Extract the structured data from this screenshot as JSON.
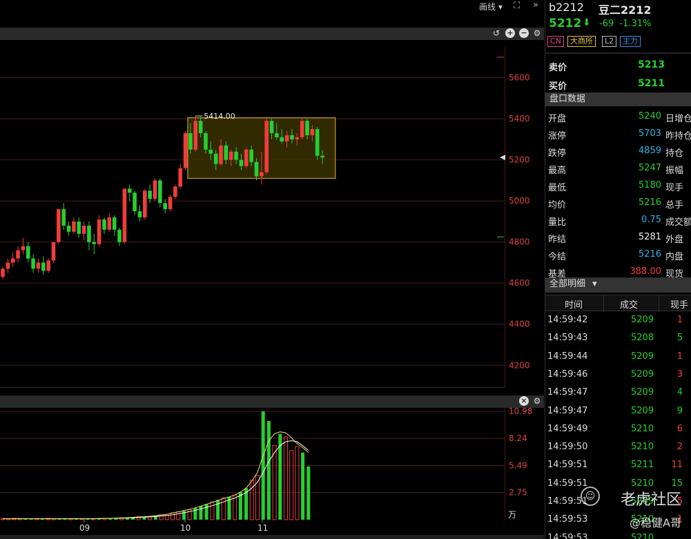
{
  "toolbar": {
    "draw_menu_label": "画线 ▾",
    "fullscreen_icon": "fullscreen-icon",
    "expand_icon": "expand-icon",
    "expand_glyph": "»",
    "fullscreen_glyph": "⛶"
  },
  "price_pane": {
    "icons": [
      "undo-icon",
      "zoom-in-icon",
      "zoom-out-icon",
      "gear-icon"
    ]
  },
  "vol_pane": {
    "icons": [
      "close-icon",
      "gear-icon"
    ]
  },
  "header": {
    "symbol_code": "b2212",
    "symbol_name": "豆二2212",
    "last_price": "5212",
    "arrow": "🡇",
    "change": "-69",
    "change_pct": "-1.31%",
    "tags": [
      {
        "label": "CN",
        "color": "#e2438a"
      },
      {
        "label": "大商所",
        "color": "#e2c23a"
      },
      {
        "label": "L2",
        "color": "#bbbbbb"
      },
      {
        "label": "主力",
        "color": "#3a8ee2"
      }
    ]
  },
  "quotes": [
    {
      "label": "卖价",
      "value": "5213"
    },
    {
      "label": "买价",
      "value": "5211"
    }
  ],
  "market_data": {
    "title": "盘口数据",
    "rows": [
      {
        "label": "开盘",
        "value": "5240",
        "color": "#25d02f",
        "label2": "日增仓"
      },
      {
        "label": "涨停",
        "value": "5703",
        "color": "#2eb8e8",
        "label2": "昨持仓"
      },
      {
        "label": "跌停",
        "value": "4859",
        "color": "#2eb8e8",
        "label2": "持仓"
      },
      {
        "label": "最高",
        "value": "5247",
        "color": "#25d02f",
        "label2": "振幅"
      },
      {
        "label": "最低",
        "value": "5180",
        "color": "#25d02f",
        "label2": "现手"
      },
      {
        "label": "均价",
        "value": "5216",
        "color": "#25d02f",
        "label2": "总手"
      },
      {
        "label": "量比",
        "value": "0.75",
        "color": "#2eb8e8",
        "label2": "成交额"
      },
      {
        "label": "昨结",
        "value": "5281",
        "color": "#eeeeee",
        "label2": "外盘"
      },
      {
        "label": "今结",
        "value": "5216",
        "color": "#2eb8e8",
        "label2": "内盘"
      },
      {
        "label": "基差",
        "value": "388.00",
        "color": "#f03c3c",
        "label2": "现货"
      }
    ]
  },
  "ticks": {
    "title": "全部明细",
    "dropdown_icon": "▾",
    "headers": [
      "时间",
      "成交",
      "现手"
    ],
    "rows": [
      {
        "time": "14:59:42",
        "price": "5209",
        "vol": "1",
        "color": "#f03c3c"
      },
      {
        "time": "14:59:43",
        "price": "5208",
        "vol": "5",
        "color": "#25d02f"
      },
      {
        "time": "14:59:44",
        "price": "5209",
        "vol": "1",
        "color": "#f03c3c"
      },
      {
        "time": "14:59:46",
        "price": "5209",
        "vol": "3",
        "color": "#f03c3c"
      },
      {
        "time": "14:59:47",
        "price": "5209",
        "vol": "4",
        "color": "#25d02f"
      },
      {
        "time": "14:59:47",
        "price": "5209",
        "vol": "9",
        "color": "#25d02f"
      },
      {
        "time": "14:59:49",
        "price": "5210",
        "vol": "6",
        "color": "#f03c3c"
      },
      {
        "time": "14:59:50",
        "price": "5210",
        "vol": "2",
        "color": "#f03c3c"
      },
      {
        "time": "14:59:51",
        "price": "5211",
        "vol": "11",
        "color": "#f03c3c"
      },
      {
        "time": "14:59:51",
        "price": "5210",
        "vol": "15",
        "color": "#25d02f"
      },
      {
        "time": "14:59:51",
        "price": "5209",
        "vol": "5",
        "color": "#f03c3c"
      },
      {
        "time": "14:59:53",
        "price": "5210",
        "vol": "1",
        "color": "#f03c3c"
      },
      {
        "time": "14:59:53",
        "price": "5210",
        "vol": "",
        "color": "#f03c3c"
      }
    ]
  },
  "watermark": {
    "site": "老虎社区",
    "author": "@稳健A哥",
    "icon": "tiger-logo-icon"
  },
  "colors": {
    "up": "#f03c3c",
    "down": "#25d02f",
    "box_border": "#c8a020",
    "box_fill": "#3a3000",
    "ma_yellow": "#f0e060",
    "ma_white": "#ffffff"
  },
  "chart_data": [
    {
      "type": "candlestick",
      "y_ticks": [
        4200,
        4400,
        4600,
        4800,
        5000,
        5200,
        5400,
        5600
      ],
      "y_tick_labels": [
        "4200",
        "4400",
        "4600",
        "4800",
        "5000",
        "5200",
        "5400",
        "5600"
      ],
      "ylim": [
        4090,
        5750
      ],
      "x_labels": [
        "09",
        "10",
        "11"
      ],
      "grid": true,
      "annotation": {
        "label": "5414.00",
        "value": 5414
      },
      "consolidation_box": {
        "start_index": 37,
        "end_index": 65,
        "high": 5405,
        "low": 5110
      },
      "candles": [
        [
          4630,
          4680,
          4620,
          4670
        ],
        [
          4670,
          4720,
          4650,
          4700
        ],
        [
          4700,
          4750,
          4680,
          4720
        ],
        [
          4720,
          4780,
          4700,
          4760
        ],
        [
          4760,
          4820,
          4740,
          4780
        ],
        [
          4780,
          4800,
          4700,
          4720
        ],
        [
          4720,
          4740,
          4650,
          4670
        ],
        [
          4670,
          4720,
          4650,
          4700
        ],
        [
          4700,
          4730,
          4640,
          4660
        ],
        [
          4660,
          4720,
          4650,
          4710
        ],
        [
          4710,
          4800,
          4700,
          4800
        ],
        [
          4800,
          4960,
          4790,
          4960
        ],
        [
          4960,
          4990,
          4860,
          4880
        ],
        [
          4880,
          4900,
          4830,
          4850
        ],
        [
          4850,
          4920,
          4840,
          4900
        ],
        [
          4900,
          4920,
          4820,
          4840
        ],
        [
          4840,
          4900,
          4810,
          4880
        ],
        [
          4880,
          4900,
          4760,
          4800
        ],
        [
          4800,
          4840,
          4740,
          4790
        ],
        [
          4790,
          4930,
          4780,
          4910
        ],
        [
          4910,
          4920,
          4840,
          4860
        ],
        [
          4860,
          4940,
          4850,
          4920
        ],
        [
          4920,
          4930,
          4830,
          4860
        ],
        [
          4860,
          4870,
          4780,
          4800
        ],
        [
          4800,
          5060,
          4790,
          5060
        ],
        [
          5060,
          5080,
          5000,
          5040
        ],
        [
          5040,
          5050,
          4930,
          4950
        ],
        [
          4950,
          4980,
          4900,
          4920
        ],
        [
          4920,
          5060,
          4910,
          5050
        ],
        [
          5050,
          5080,
          4990,
          5010
        ],
        [
          5010,
          5110,
          5000,
          5100
        ],
        [
          5100,
          5110,
          4970,
          4990
        ],
        [
          4990,
          5010,
          4940,
          4960
        ],
        [
          4960,
          5030,
          4950,
          5020
        ],
        [
          5020,
          5080,
          5010,
          5070
        ],
        [
          5070,
          5180,
          5060,
          5160
        ],
        [
          5160,
          5340,
          5150,
          5330
        ],
        [
          5330,
          5380,
          5230,
          5250
        ],
        [
          5250,
          5414,
          5240,
          5390
        ],
        [
          5390,
          5410,
          5310,
          5330
        ],
        [
          5330,
          5340,
          5230,
          5250
        ],
        [
          5250,
          5290,
          5200,
          5230
        ],
        [
          5230,
          5250,
          5150,
          5180
        ],
        [
          5180,
          5300,
          5170,
          5270
        ],
        [
          5270,
          5290,
          5180,
          5200
        ],
        [
          5200,
          5250,
          5170,
          5240
        ],
        [
          5240,
          5260,
          5180,
          5200
        ],
        [
          5200,
          5230,
          5150,
          5170
        ],
        [
          5170,
          5260,
          5160,
          5250
        ],
        [
          5250,
          5270,
          5170,
          5190
        ],
        [
          5190,
          5210,
          5100,
          5120
        ],
        [
          5120,
          5240,
          5080,
          5140
        ],
        [
          5140,
          5410,
          5130,
          5390
        ],
        [
          5390,
          5400,
          5300,
          5330
        ],
        [
          5330,
          5380,
          5300,
          5310
        ],
        [
          5310,
          5350,
          5280,
          5290
        ],
        [
          5290,
          5340,
          5260,
          5320
        ],
        [
          5320,
          5350,
          5280,
          5300
        ],
        [
          5300,
          5330,
          5270,
          5310
        ],
        [
          5310,
          5400,
          5300,
          5390
        ],
        [
          5390,
          5400,
          5300,
          5320
        ],
        [
          5320,
          5370,
          5290,
          5350
        ],
        [
          5350,
          5360,
          5200,
          5220
        ],
        [
          5220,
          5247,
          5180,
          5212
        ]
      ]
    },
    {
      "type": "bar",
      "y_ticks": [
        2.75,
        5.49,
        8.24,
        10.98
      ],
      "y_tick_labels": [
        "2.75",
        "5.49",
        "8.24",
        "10.98"
      ],
      "unit": "万",
      "ylim": [
        0,
        10.98
      ],
      "values": [
        0.1,
        0.1,
        0.15,
        0.12,
        0.1,
        0.1,
        0.12,
        0.1,
        0.15,
        0.1,
        0.12,
        0.1,
        0.12,
        0.15,
        0.1,
        0.12,
        0.1,
        0.15,
        0.12,
        0.1,
        0.18,
        0.2,
        0.2,
        0.25,
        0.3,
        0.28,
        0.35,
        0.4,
        0.5,
        0.45,
        0.7,
        0.8,
        0.9,
        1.0,
        1.2,
        1.4,
        1.6,
        1.8,
        2.0,
        2.2,
        2.3,
        2.5,
        2.8,
        3.2,
        4.0,
        4.5,
        10.98,
        10.0,
        7.5,
        8.7,
        8.4,
        7.0,
        7.4,
        6.8,
        5.4
      ],
      "ma_fast": [
        0.1,
        0.1,
        0.1,
        0.1,
        0.1,
        0.1,
        0.1,
        0.1,
        0.1,
        0.1,
        0.1,
        0.1,
        0.1,
        0.1,
        0.1,
        0.1,
        0.1,
        0.12,
        0.13,
        0.14,
        0.16,
        0.18,
        0.2,
        0.24,
        0.28,
        0.3,
        0.34,
        0.4,
        0.48,
        0.55,
        0.68,
        0.8,
        0.92,
        1.05,
        1.2,
        1.38,
        1.56,
        1.75,
        1.95,
        2.15,
        2.3,
        2.5,
        2.8,
        3.2,
        3.9,
        4.8,
        6.5,
        8.0,
        8.7,
        8.9,
        8.8,
        8.3,
        7.7,
        7.3,
        6.8
      ],
      "ma_slow": [
        0.1,
        0.1,
        0.1,
        0.1,
        0.1,
        0.1,
        0.1,
        0.1,
        0.1,
        0.1,
        0.1,
        0.1,
        0.1,
        0.1,
        0.1,
        0.1,
        0.1,
        0.11,
        0.12,
        0.13,
        0.14,
        0.15,
        0.17,
        0.19,
        0.22,
        0.25,
        0.28,
        0.32,
        0.37,
        0.43,
        0.5,
        0.6,
        0.7,
        0.82,
        0.95,
        1.1,
        1.25,
        1.42,
        1.6,
        1.8,
        2.0,
        2.2,
        2.45,
        2.75,
        3.2,
        3.8,
        4.8,
        5.9,
        6.8,
        7.5,
        7.9,
        8.0,
        7.9,
        7.5,
        7.0
      ]
    }
  ]
}
